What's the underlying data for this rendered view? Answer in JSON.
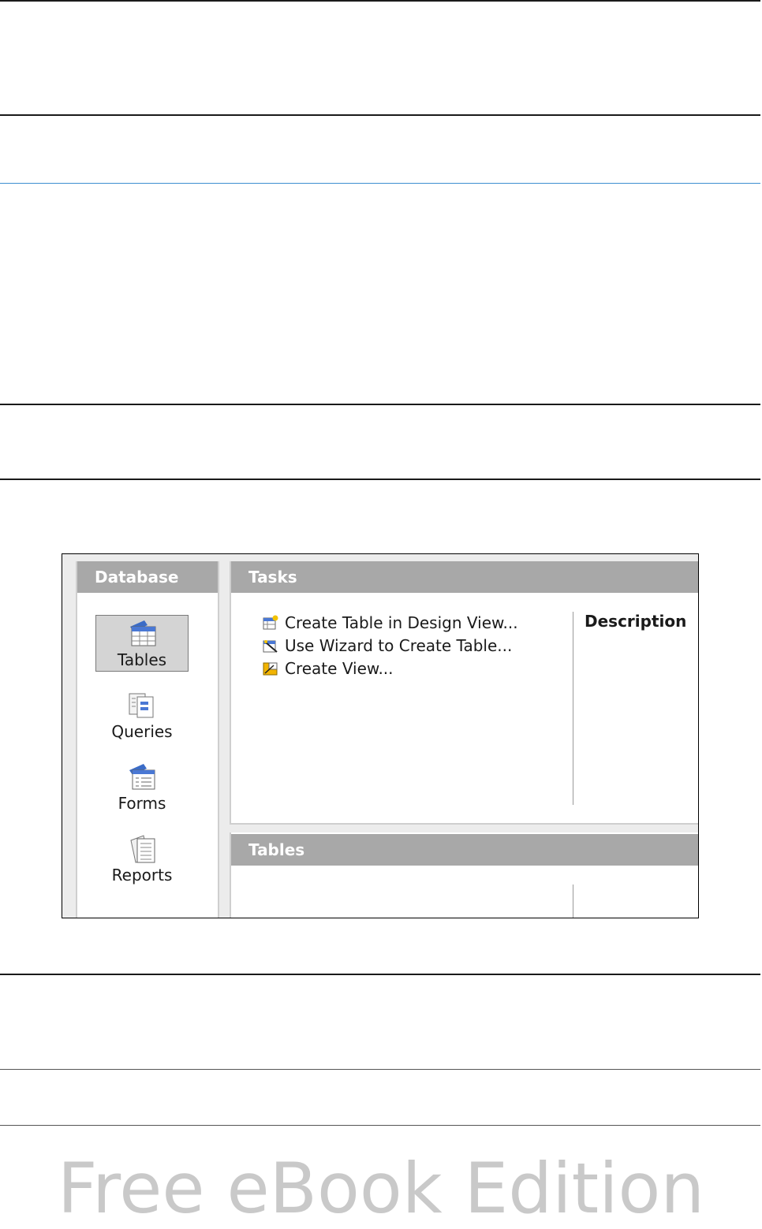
{
  "database_panel": {
    "header": "Database",
    "items": [
      {
        "label": "Tables",
        "selected": true
      },
      {
        "label": "Queries",
        "selected": false
      },
      {
        "label": "Forms",
        "selected": false
      },
      {
        "label": "Reports",
        "selected": false
      }
    ]
  },
  "tasks_panel": {
    "header": "Tasks",
    "items": [
      {
        "label": "Create Table in Design View...",
        "icon": "design-view-icon"
      },
      {
        "label": "Use Wizard to Create Table...",
        "icon": "wizard-icon"
      },
      {
        "label": "Create View...",
        "icon": "create-view-icon"
      }
    ],
    "description_label": "Description"
  },
  "tables_panel": {
    "header": "Tables"
  },
  "watermark": "Free eBook Edition",
  "colors": {
    "header_bg": "#a8a8a8",
    "selected_bg": "#d4d4d4",
    "accent_blue": "#3d8fd1",
    "watermark": "#c9c9c9"
  }
}
